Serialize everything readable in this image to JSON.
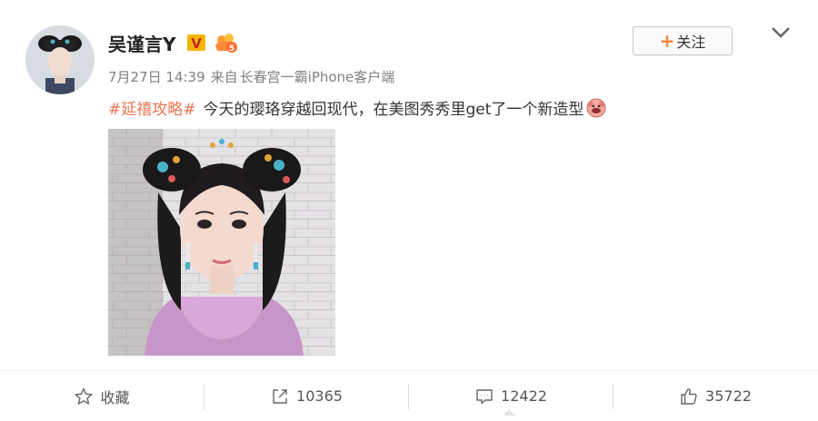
{
  "post": {
    "user": {
      "name": "吴谨言Y"
    },
    "follow_label": "关注",
    "meta": {
      "date": "7月27日 14:39",
      "source_prefix": "来自",
      "source": "长春宫一霸iPhone客户端"
    },
    "hashtag": "#延禧攻略#",
    "text": "今天的璎珞穿越回现代，在美图秀秀里get了一个新造型"
  },
  "actions": {
    "favorite_label": "收藏",
    "repost_count": "10365",
    "comment_count": "12422",
    "like_count": "35722"
  },
  "colors": {
    "accent": "#eb7350",
    "plus": "#ff8140",
    "verified": "#f5b400"
  },
  "icons": [
    "chevron-down-icon",
    "verified-icon",
    "level-icon",
    "emoji-icon",
    "star-icon",
    "repost-icon",
    "comment-icon",
    "like-icon"
  ]
}
